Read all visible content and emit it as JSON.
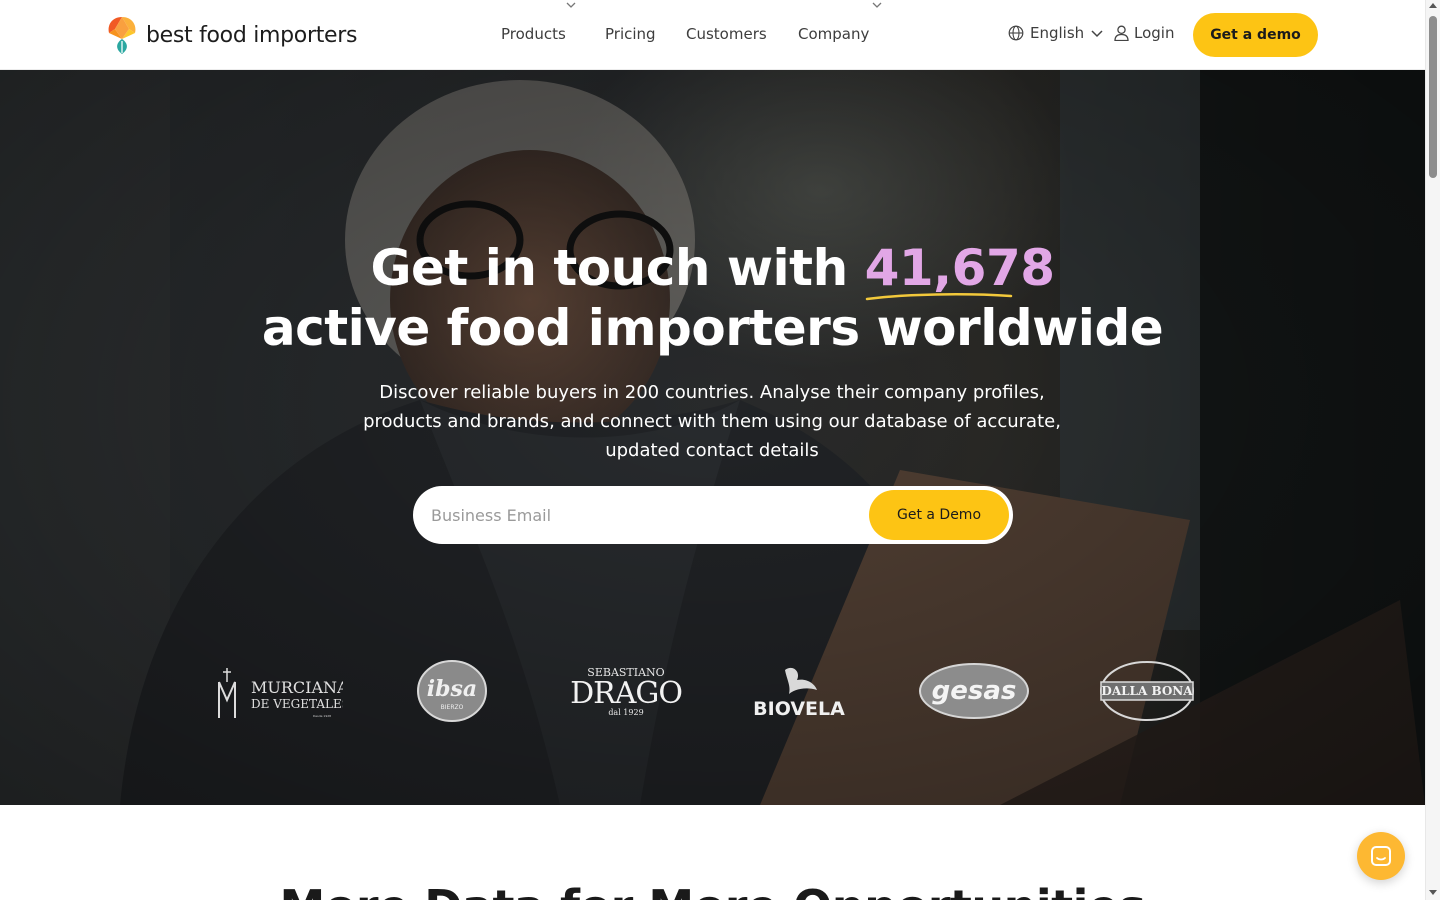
{
  "header": {
    "logo_text": "best food importers",
    "nav": {
      "products": "Products",
      "pricing": "Pricing",
      "customers": "Customers",
      "company": "Company"
    },
    "language": "English",
    "login": "Login",
    "cta": "Get a demo"
  },
  "hero": {
    "title_prefix": "Get in touch with ",
    "title_number": "41,678",
    "title_line2": "active food importers worldwide",
    "subtitle": "Discover reliable buyers in 200 countries. Analyse their company profiles, products and brands, and connect with them using our database of accurate, updated contact details",
    "email_placeholder": "Business Email",
    "email_button": "Get a Demo"
  },
  "brands": [
    {
      "line1": "MURCIANA",
      "line2": "DE VEGETALES",
      "line3": "Desde 1928"
    },
    {
      "name": "ibsa",
      "sub": "BIERZO"
    },
    {
      "top": "SEBASTIANO",
      "name": "DRAGO",
      "sub": "dal 1929"
    },
    {
      "name": "BIOVELA"
    },
    {
      "name": "gesas"
    },
    {
      "name": "DALLA BONA"
    }
  ],
  "section": {
    "title": "More Data for More Opportunities"
  },
  "colors": {
    "accent_yellow": "#fdc414",
    "highlight_purple": "#e2a7e6",
    "underline_yellow": "#f3c93b",
    "chat_orange": "#fdb832"
  },
  "icons": {
    "globe": "globe-icon",
    "chevron": "chevron-down-icon",
    "user": "user-icon",
    "chat": "chat-icon"
  }
}
